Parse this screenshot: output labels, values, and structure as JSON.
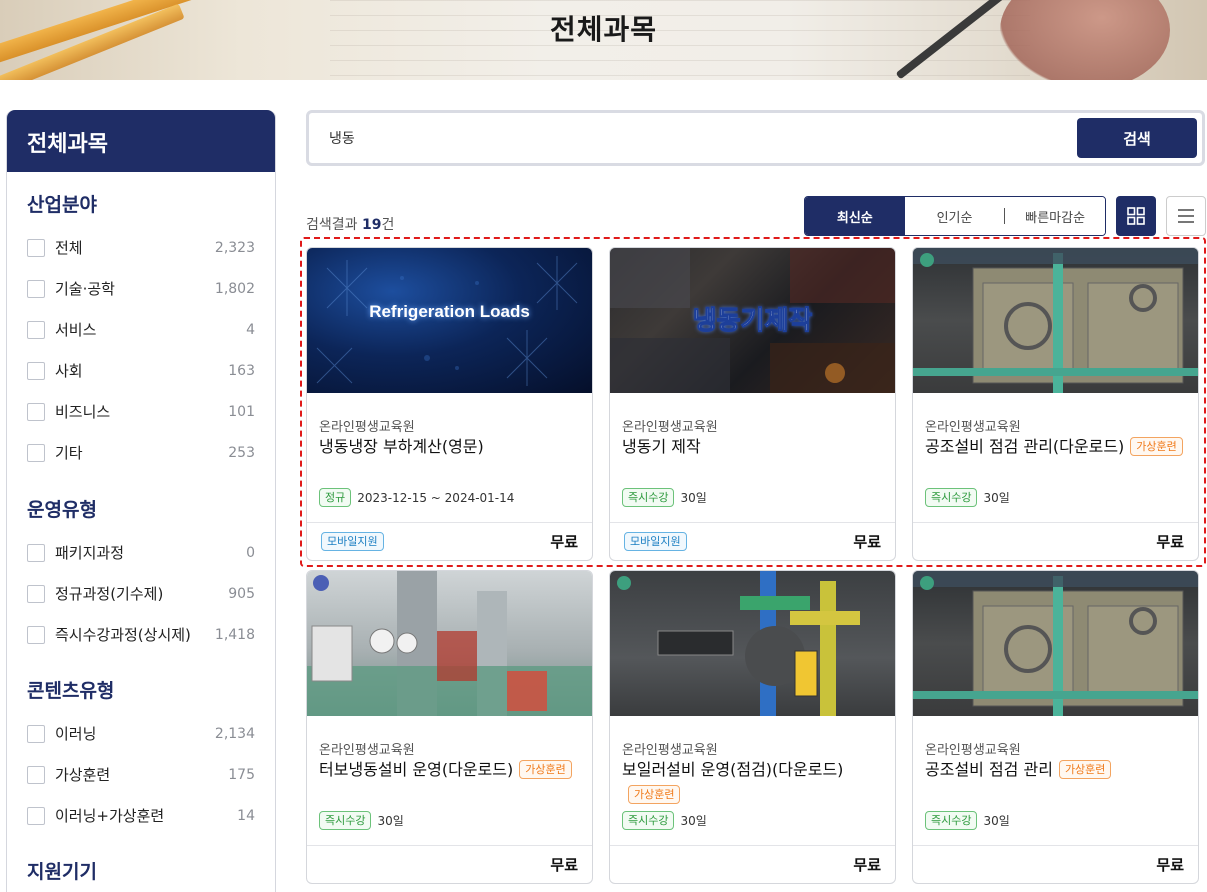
{
  "page_title": "전체과목",
  "sidebar": {
    "title": "전체과목",
    "groups": [
      {
        "title": "산업분야",
        "items": [
          {
            "label": "전체",
            "count": "2,323"
          },
          {
            "label": "기술·공학",
            "count": "1,802"
          },
          {
            "label": "서비스",
            "count": "4"
          },
          {
            "label": "사회",
            "count": "163"
          },
          {
            "label": "비즈니스",
            "count": "101"
          },
          {
            "label": "기타",
            "count": "253"
          }
        ]
      },
      {
        "title": "운영유형",
        "items": [
          {
            "label": "패키지과정",
            "count": "0"
          },
          {
            "label": "정규과정(기수제)",
            "count": "905"
          },
          {
            "label": "즉시수강과정(상시제)",
            "count": "1,418"
          }
        ]
      },
      {
        "title": "콘텐츠유형",
        "items": [
          {
            "label": "이러닝",
            "count": "2,134"
          },
          {
            "label": "가상훈련",
            "count": "175"
          },
          {
            "label": "이러닝+가상훈련",
            "count": "14"
          }
        ]
      },
      {
        "title": "지원기기",
        "items": []
      }
    ]
  },
  "search": {
    "value": "냉동",
    "placeholder": "",
    "button": "검색"
  },
  "results": {
    "prefix": "검색결과 ",
    "count": "19",
    "suffix": "건"
  },
  "sort": {
    "options": [
      "최신순",
      "인기순",
      "빠른마감순"
    ],
    "active": "최신순"
  },
  "view": {
    "grid_icon": "grid-icon",
    "list_icon": "list-icon",
    "active": "grid"
  },
  "colors": {
    "primary": "#1f2d66",
    "virtual_badge": "#f07a1a",
    "green_badge": "#2d9a3d",
    "blue_badge": "#1b7ec2",
    "highlight": "#e01a1a"
  },
  "cards": [
    {
      "provider": "온라인평생교육원",
      "title": "냉동냉장 부하계산(영문)",
      "virtual_badge": "",
      "type_badge": "정규",
      "meta": "2023-12-15 ~ 2024-01-14",
      "mobile": "모바일지원",
      "price": "무료",
      "thumb_text": "Refrigeration Loads"
    },
    {
      "provider": "온라인평생교육원",
      "title": "냉동기 제작",
      "virtual_badge": "",
      "type_badge": "즉시수강",
      "meta": "30일",
      "mobile": "모바일지원",
      "price": "무료",
      "thumb_text": "냉동기제작"
    },
    {
      "provider": "온라인평생교육원",
      "title": "공조설비 점검 관리(다운로드)",
      "virtual_badge": "가상훈련",
      "type_badge": "즉시수강",
      "meta": "30일",
      "mobile": "",
      "price": "무료",
      "thumb_text": ""
    },
    {
      "provider": "온라인평생교육원",
      "title": "터보냉동설비 운영(다운로드)",
      "virtual_badge": "가상훈련",
      "type_badge": "즉시수강",
      "meta": "30일",
      "mobile": "",
      "price": "무료",
      "thumb_text": ""
    },
    {
      "provider": "온라인평생교육원",
      "title": "보일러설비 운영(점검)(다운로드)",
      "virtual_badge": "가상훈련",
      "type_badge": "즉시수강",
      "meta": "30일",
      "mobile": "",
      "price": "무료",
      "thumb_text": ""
    },
    {
      "provider": "온라인평생교육원",
      "title": "공조설비 점검 관리",
      "virtual_badge": "가상훈련",
      "type_badge": "즉시수강",
      "meta": "30일",
      "mobile": "",
      "price": "무료",
      "thumb_text": ""
    }
  ]
}
